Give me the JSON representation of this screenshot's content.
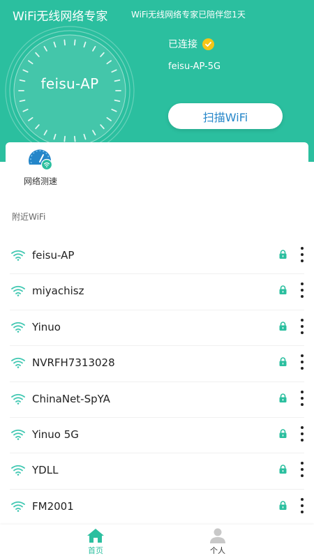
{
  "header": {
    "title": "WiFi无线网络专家",
    "subtitle": "WiFi无线网络专家已陪伴您1天",
    "gauge_ssid": "feisu-AP",
    "connection_status": "已连接",
    "connected_ssid": "feisu-AP-5G",
    "scan_button_label": "扫描WiFi"
  },
  "tools": [
    {
      "label": "网络测速",
      "icon": "speedometer-icon"
    }
  ],
  "nearby": {
    "section_label": "附近WiFi",
    "networks": [
      {
        "ssid": "feisu-AP",
        "secured": true
      },
      {
        "ssid": "miyachisz",
        "secured": true
      },
      {
        "ssid": "Yinuo",
        "secured": true
      },
      {
        "ssid": "NVRFH7313028",
        "secured": true
      },
      {
        "ssid": "ChinaNet-SpYA",
        "secured": true
      },
      {
        "ssid": "Yinuo 5G",
        "secured": true
      },
      {
        "ssid": "YDLL",
        "secured": true
      },
      {
        "ssid": "FM2001",
        "secured": true
      }
    ]
  },
  "bottom_nav": {
    "items": [
      {
        "label": "首页",
        "icon": "home-icon",
        "active": true
      },
      {
        "label": "个人",
        "icon": "person-icon",
        "active": false
      }
    ]
  },
  "colors": {
    "primary": "#2bbf9f",
    "scan_text": "#2486c9",
    "check_badge": "#f5c518",
    "wifi_icon": "#3fc7b1",
    "lock_icon": "#2bbf9f"
  }
}
